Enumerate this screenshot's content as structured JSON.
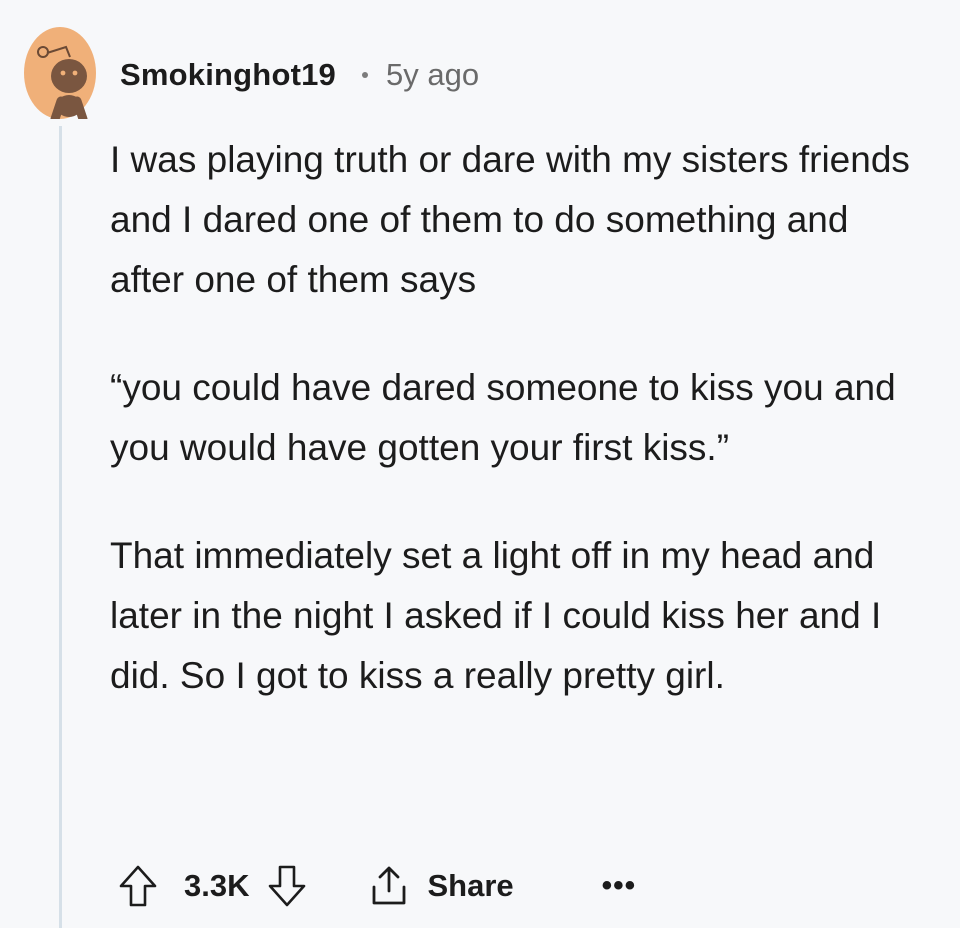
{
  "comment": {
    "author": "Smokinghot19",
    "timestamp": "5y ago",
    "paragraphs": [
      "I was playing truth or dare with my sisters friends and I dared one of them to do something and after one of them says",
      "“you could have dared someone to kiss you and you would have gotten your first kiss.”",
      "That immediately set a light off in my head and later in the night I asked if I could kiss her and I did. So I got to kiss a really pretty girl."
    ]
  },
  "actions": {
    "vote_count": "3.3K",
    "share_label": "Share",
    "more_label": "•••"
  },
  "icons": {
    "avatar": "snoo-avatar-icon",
    "upvote": "upvote-arrow-icon",
    "downvote": "downvote-arrow-icon",
    "share": "share-icon",
    "more": "more-options-icon"
  },
  "colors": {
    "background": "#f7f8fa",
    "avatar": "#f0b079",
    "thread_line": "#d6e0e8",
    "text": "#1c1c1c",
    "meta_text": "#6a6a6a"
  }
}
